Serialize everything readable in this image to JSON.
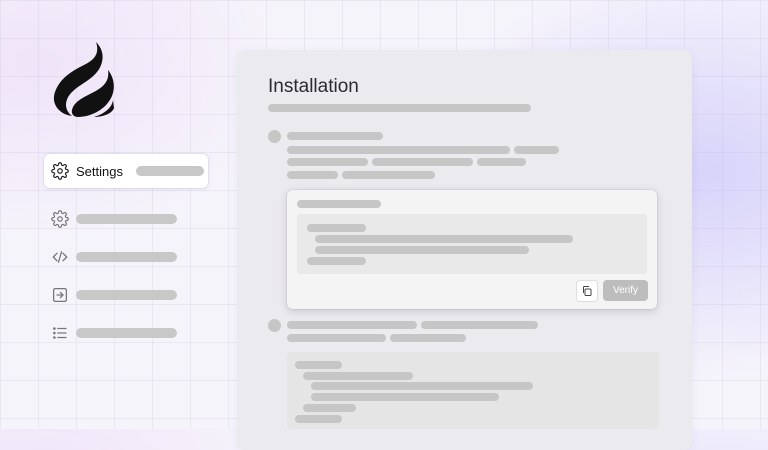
{
  "brand": {
    "logo_icon": "flame-logo"
  },
  "sidebar": {
    "items": [
      {
        "icon": "gear-icon",
        "label": "Settings",
        "active": true
      },
      {
        "icon": "gear-icon",
        "label": ""
      },
      {
        "icon": "code-icon",
        "label": ""
      },
      {
        "icon": "arrow-right-box-icon",
        "label": ""
      },
      {
        "icon": "list-icon",
        "label": ""
      }
    ]
  },
  "main": {
    "title": "Installation",
    "verify_card": {
      "copy_icon": "copy-icon",
      "verify_label": "Verify"
    }
  },
  "colors": {
    "placeholder": "#c6c6c6",
    "panel": "#ebeaee",
    "verify_button": "#bdbdbd",
    "logo": "#111111"
  }
}
